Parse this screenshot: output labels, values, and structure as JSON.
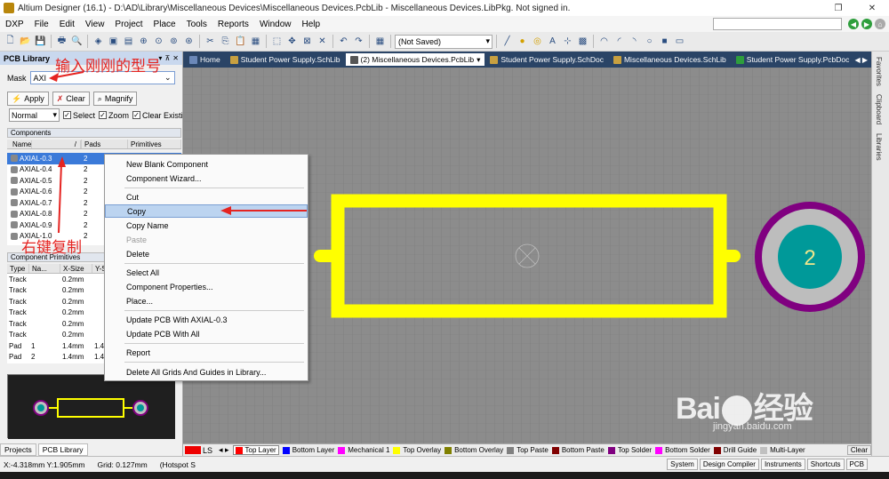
{
  "window": {
    "title": "Altium Designer (16.1) - D:\\AD\\Library\\Miscellaneous Devices\\Miscellaneous Devices.PcbLib - Miscellaneous Devices.LibPkg. Not signed in."
  },
  "menu": {
    "items": [
      "DXP",
      "File",
      "Edit",
      "View",
      "Project",
      "Place",
      "Tools",
      "Reports",
      "Window",
      "Help"
    ]
  },
  "toolbar": {
    "saved_state": "(Not Saved)"
  },
  "panel": {
    "title": "PCB Library",
    "mask_label": "Mask",
    "mask_value": "AXI",
    "apply_label": "Apply",
    "clear_label": "Clear",
    "magnify_label": "Magnify",
    "mode_value": "Normal",
    "select_label": "Select",
    "zoom_label": "Zoom",
    "clear_existing_label": "Clear Existin",
    "components_title": "Components",
    "col_name": "Name",
    "col_pads": "Pads",
    "col_primitives": "Primitives",
    "components": [
      {
        "name": "AXIAL-0.3",
        "pads": "2"
      },
      {
        "name": "AXIAL-0.4",
        "pads": "2"
      },
      {
        "name": "AXIAL-0.5",
        "pads": "2"
      },
      {
        "name": "AXIAL-0.6",
        "pads": "2"
      },
      {
        "name": "AXIAL-0.7",
        "pads": "2"
      },
      {
        "name": "AXIAL-0.8",
        "pads": "2"
      },
      {
        "name": "AXIAL-0.9",
        "pads": "2"
      },
      {
        "name": "AXIAL-1.0",
        "pads": "2"
      }
    ],
    "primitives_title": "Component Primitives",
    "pcol_type": "Type",
    "pcol_name": "Na...",
    "pcol_xsize": "X-Size",
    "pcol_ysize": "Y-S",
    "primitives": [
      {
        "type": "Track",
        "name": "",
        "xsize": "0.2mm",
        "ysize": ""
      },
      {
        "type": "Track",
        "name": "",
        "xsize": "0.2mm",
        "ysize": ""
      },
      {
        "type": "Track",
        "name": "",
        "xsize": "0.2mm",
        "ysize": ""
      },
      {
        "type": "Track",
        "name": "",
        "xsize": "0.2mm",
        "ysize": ""
      },
      {
        "type": "Track",
        "name": "",
        "xsize": "0.2mm",
        "ysize": ""
      },
      {
        "type": "Track",
        "name": "",
        "xsize": "0.2mm",
        "ysize": ""
      },
      {
        "type": "Pad",
        "name": "1",
        "xsize": "1.4mm",
        "ysize": "1.4"
      },
      {
        "type": "Pad",
        "name": "2",
        "xsize": "1.4mm",
        "ysize": "1.4"
      }
    ],
    "bottom_tabs": [
      "Projects",
      "PCB Library"
    ]
  },
  "doc_tabs": [
    {
      "label": "Home",
      "active": false
    },
    {
      "label": "Student Power Supply.SchLib",
      "active": false
    },
    {
      "label": "(2) Miscellaneous Devices.PcbLib",
      "active": true
    },
    {
      "label": "Student Power Supply.SchDoc",
      "active": false
    },
    {
      "label": "Miscellaneous Devices.SchLib",
      "active": false
    },
    {
      "label": "Student Power Supply.PcbDoc",
      "active": false
    }
  ],
  "right_tabs": [
    "Favorites",
    "Clipboard",
    "Libraries"
  ],
  "canvas": {
    "pad_label": "2",
    "overlay_color": "#ffff00",
    "pad_copper_color": "#009999",
    "pad_ring_color": "#bdbdbd",
    "pad_outer_color": "#800080"
  },
  "context_menu": {
    "items": [
      {
        "label": "New Blank Component",
        "disabled": false,
        "highlighted": false
      },
      {
        "label": "Component Wizard...",
        "disabled": false,
        "highlighted": false
      },
      {
        "label": "Cut",
        "disabled": false,
        "highlighted": false
      },
      {
        "label": "Copy",
        "disabled": false,
        "highlighted": true
      },
      {
        "label": "Copy Name",
        "disabled": false,
        "highlighted": false
      },
      {
        "label": "Paste",
        "disabled": true,
        "highlighted": false
      },
      {
        "label": "Delete",
        "disabled": false,
        "highlighted": false
      },
      {
        "label": "Select All",
        "disabled": false,
        "highlighted": false
      },
      {
        "label": "Component Properties...",
        "disabled": false,
        "highlighted": false
      },
      {
        "label": "Place...",
        "disabled": false,
        "highlighted": false
      },
      {
        "label": "Update PCB With AXIAL-0.3",
        "disabled": false,
        "highlighted": false
      },
      {
        "label": "Update PCB With All",
        "disabled": false,
        "highlighted": false
      },
      {
        "label": "Report",
        "disabled": false,
        "highlighted": false
      },
      {
        "label": "Delete All Grids And Guides in Library...",
        "disabled": false,
        "highlighted": false
      }
    ]
  },
  "layers": [
    {
      "label": "LS",
      "color": "#ff0000"
    },
    {
      "label": "Top Layer",
      "color": "#ff0000",
      "current": true
    },
    {
      "label": "Bottom Layer",
      "color": "#0000ff"
    },
    {
      "label": "Mechanical 1",
      "color": "#ff00ff"
    },
    {
      "label": "Top Overlay",
      "color": "#ffff00"
    },
    {
      "label": "Bottom Overlay",
      "color": "#808000"
    },
    {
      "label": "Top Paste",
      "color": "#808080"
    },
    {
      "label": "Bottom Paste",
      "color": "#800000"
    },
    {
      "label": "Top Solder",
      "color": "#800080"
    },
    {
      "label": "Bottom Solder",
      "color": "#ff00ff"
    },
    {
      "label": "Drill Guide",
      "color": "#800000"
    },
    {
      "label": "Multi-Layer",
      "color": "#c0c0c0"
    }
  ],
  "layer_clear": "Clear",
  "status": {
    "coords": "X:-4.318mm Y:1.905mm",
    "grid": "Grid: 0.127mm",
    "hotspot": "(Hotspot S",
    "buttons": [
      "System",
      "Design Compiler",
      "Instruments",
      "Shortcuts",
      "PCB"
    ]
  },
  "annotations": {
    "top": "输入刚刚的型号",
    "bottom": "右键复制"
  },
  "watermark": {
    "brand": "Bai",
    "brand2": "经验",
    "sub": "jingyan.baidu.com"
  }
}
